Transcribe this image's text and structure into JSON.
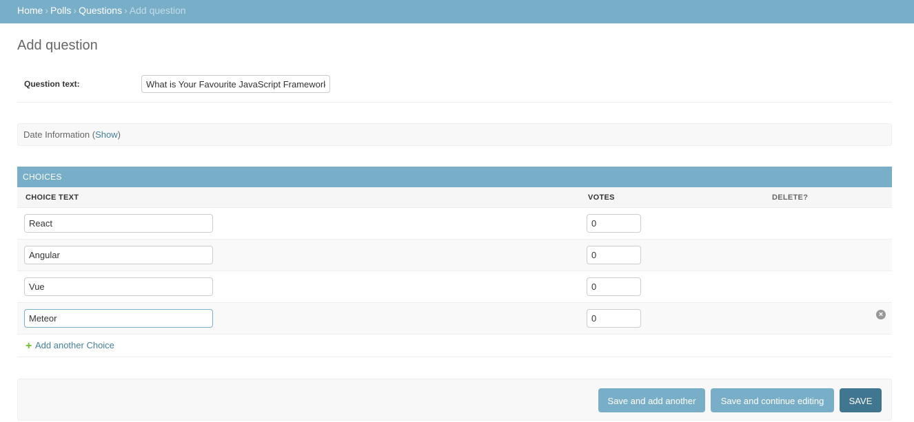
{
  "breadcrumbs": {
    "home": "Home",
    "polls": "Polls",
    "questions": "Questions",
    "current": "Add question",
    "separator": "›"
  },
  "page_title": "Add question",
  "question_text": {
    "label": "Question text:",
    "value": "What is Your Favourite JavaScript Framework"
  },
  "date_info": {
    "label": "Date Information",
    "open_paren": " (",
    "toggle": "Show",
    "close_paren": ")"
  },
  "choices": {
    "caption": "CHOICES",
    "headers": {
      "choice_text": "Choice text",
      "votes": "Votes",
      "delete": "Delete?"
    },
    "rows": [
      {
        "choice": "React",
        "votes": "0"
      },
      {
        "choice": "Angular",
        "votes": "0"
      },
      {
        "choice": "Vue",
        "votes": "0"
      },
      {
        "choice": "Meteor",
        "votes": "0"
      }
    ],
    "add_link": "Add another Choice"
  },
  "submit": {
    "save_add_another": "Save and add another",
    "save_continue": "Save and continue editing",
    "save": "SAVE"
  },
  "colors": {
    "header_blue": "#79aec8",
    "link_blue": "#447e9b",
    "save_blue": "#417690",
    "add_green": "#70bf2b"
  }
}
